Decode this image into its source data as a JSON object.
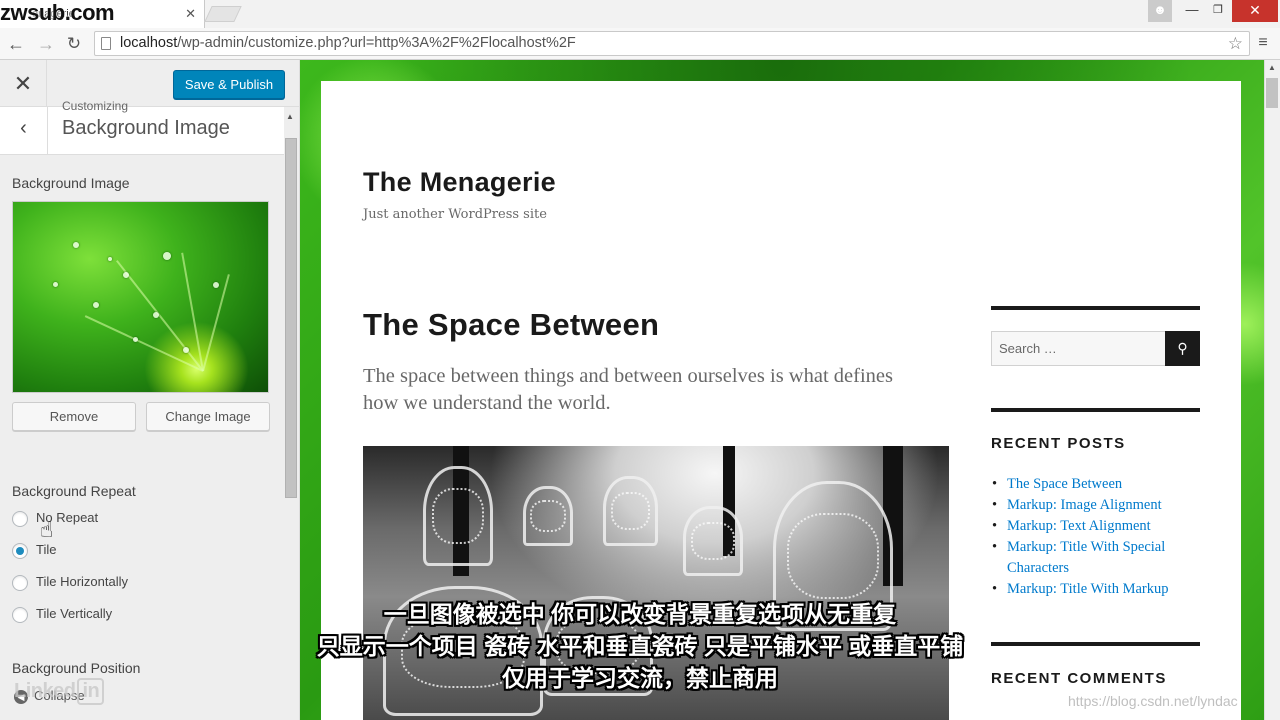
{
  "watermark": {
    "text": "zwsub.com"
  },
  "browser": {
    "tab_title": "enagerie",
    "tab_close": "✕",
    "url_host": "localhost",
    "url_path": "/wp-admin/customize.php?url=http%3A%2F%2Flocalhost%2F",
    "icons": {
      "back": "arrow-left-icon",
      "forward": "arrow-right-icon",
      "reload": "reload-icon",
      "star": "star-icon",
      "menu": "menu-icon"
    }
  },
  "customizer": {
    "close_glyph": "✕",
    "publish_label": "Save & Publish",
    "breadcrumb": "Customizing",
    "section_title": "Background Image",
    "image_label": "Background Image",
    "remove_label": "Remove",
    "change_label": "Change Image",
    "repeat_label": "Background Repeat",
    "repeat_options": [
      {
        "label": "No Repeat",
        "checked": false
      },
      {
        "label": "Tile",
        "checked": true
      },
      {
        "label": "Tile Horizontally",
        "checked": false
      },
      {
        "label": "Tile Vertically",
        "checked": false
      }
    ],
    "position_label": "Background Position",
    "collapse_label": "Collapse",
    "linkedin": "Linked"
  },
  "site": {
    "title": "The Menagerie",
    "description": "Just another WordPress site",
    "post_title": "The Space Between",
    "post_excerpt": "The space between things and between ourselves is what defines how we understand the world.",
    "search_placeholder": "Search …",
    "recent_posts_title": "RECENT POSTS",
    "recent_posts": [
      "The Space Between",
      "Markup: Image Alignment",
      "Markup: Text Alignment",
      "Markup: Title With Special Characters",
      "Markup: Title With Markup"
    ],
    "recent_comments_title": "RECENT COMMENTS",
    "colors": {
      "accent": "#0085ba",
      "link": "#007acc",
      "text": "#1a1a1a"
    }
  },
  "subtitles": {
    "line1": "一旦图像被选中 你可以改变背景重复选项从无重复",
    "line2": "只显示一个项目 瓷砖 水平和垂直瓷砖 只是平铺水平 或垂直平铺",
    "line3": "仅用于学习交流，禁止商用"
  },
  "csdn_watermark": "https://blog.csdn.net/lyndac"
}
